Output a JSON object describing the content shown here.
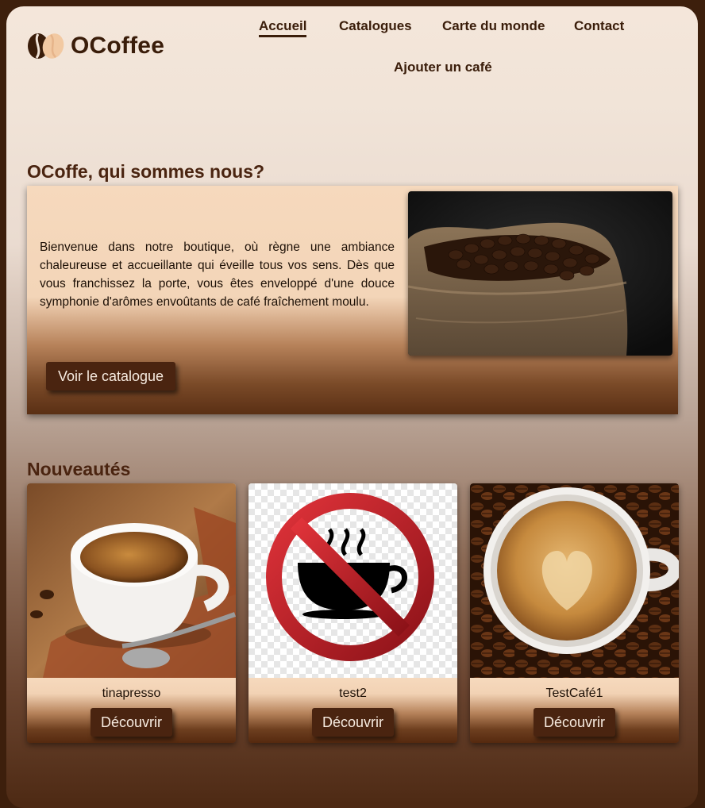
{
  "brand": {
    "name": "OCoffee"
  },
  "nav": {
    "items": [
      {
        "label": "Accueil",
        "active": true
      },
      {
        "label": "Catalogues"
      },
      {
        "label": "Carte du monde"
      },
      {
        "label": "Contact"
      },
      {
        "label": "Ajouter un café"
      }
    ]
  },
  "about": {
    "title": "OCoffe, qui sommes nous?",
    "text": "Bienvenue dans notre boutique, où règne une ambiance chaleureuse et accueillante qui éveille tous vos sens. Dès que vous franchissez la porte, vous êtes enveloppé d'une douce symphonie d'arômes envoûtants de café fraîchement moulu.",
    "button_label": "Voir le catalogue",
    "image": "coffee-beans-sack"
  },
  "news": {
    "title": "Nouveautés",
    "products": [
      {
        "name": "tinapresso",
        "button_label": "Découvrir",
        "image": "espresso-cup"
      },
      {
        "name": "test2",
        "button_label": "Découvrir",
        "image": "no-coffee-sign"
      },
      {
        "name": "TestCafé1",
        "button_label": "Découvrir",
        "image": "latte-heart-cup"
      }
    ]
  },
  "colors": {
    "dark_brown": "#4a2410",
    "cream": "#f6d9bd",
    "frame": "#3d1f0c"
  }
}
